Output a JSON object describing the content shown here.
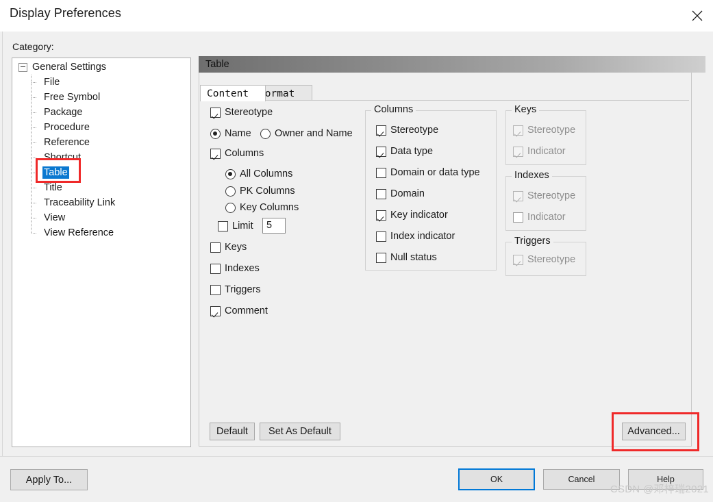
{
  "window": {
    "title": "Display Preferences",
    "close_icon": "close-icon"
  },
  "category": {
    "label": "Category:",
    "tree": [
      {
        "label": "General Settings",
        "level": 0,
        "expander": "minus",
        "selected": false
      },
      {
        "label": "File",
        "level": 1,
        "selected": false
      },
      {
        "label": "Free Symbol",
        "level": 1,
        "selected": false
      },
      {
        "label": "Package",
        "level": 1,
        "selected": false
      },
      {
        "label": "Procedure",
        "level": 1,
        "selected": false
      },
      {
        "label": "Reference",
        "level": 1,
        "selected": false
      },
      {
        "label": "Shortcut",
        "level": 1,
        "selected": false
      },
      {
        "label": "Table",
        "level": 1,
        "selected": true
      },
      {
        "label": "Title",
        "level": 1,
        "selected": false
      },
      {
        "label": "Traceability Link",
        "level": 1,
        "selected": false
      },
      {
        "label": "View",
        "level": 1,
        "selected": false
      },
      {
        "label": "View Reference",
        "level": 1,
        "selected": false
      }
    ]
  },
  "panel": {
    "header_title": "Table",
    "tabs": [
      {
        "label": "Content",
        "active": true
      },
      {
        "label": "Format",
        "active": false
      }
    ]
  },
  "content": {
    "stereotype": {
      "label": "Stereotype",
      "checked": true
    },
    "name_mode": {
      "name": {
        "label": "Name",
        "selected": true
      },
      "owner_and_name": {
        "label": "Owner and Name",
        "selected": false
      }
    },
    "columns": {
      "label": "Columns",
      "checked": true
    },
    "column_scope": {
      "all": {
        "label": "All Columns",
        "selected": true
      },
      "pk": {
        "label": "PK Columns",
        "selected": false
      },
      "key": {
        "label": "Key Columns",
        "selected": false
      }
    },
    "limit": {
      "label": "Limit",
      "checked": false,
      "value": "5"
    },
    "keys": {
      "label": "Keys",
      "checked": false
    },
    "indexes": {
      "label": "Indexes",
      "checked": false
    },
    "triggers": {
      "label": "Triggers",
      "checked": false
    },
    "comment": {
      "label": "Comment",
      "checked": true
    }
  },
  "columns_group": {
    "title": "Columns",
    "items": [
      {
        "label": "Stereotype",
        "checked": true,
        "disabled": false
      },
      {
        "label": "Data type",
        "checked": true,
        "disabled": false
      },
      {
        "label": "Domain or data type",
        "checked": false,
        "disabled": false
      },
      {
        "label": "Domain",
        "checked": false,
        "disabled": false
      },
      {
        "label": "Key indicator",
        "checked": true,
        "disabled": false
      },
      {
        "label": "Index indicator",
        "checked": false,
        "disabled": false
      },
      {
        "label": "Null status",
        "checked": false,
        "disabled": false
      }
    ]
  },
  "keys_group": {
    "title": "Keys",
    "items": [
      {
        "label": "Stereotype",
        "checked": true,
        "disabled": true
      },
      {
        "label": "Indicator",
        "checked": true,
        "disabled": true
      }
    ]
  },
  "indexes_group": {
    "title": "Indexes",
    "items": [
      {
        "label": "Stereotype",
        "checked": true,
        "disabled": true
      },
      {
        "label": "Indicator",
        "checked": false,
        "disabled": true
      }
    ]
  },
  "triggers_group": {
    "title": "Triggers",
    "items": [
      {
        "label": "Stereotype",
        "checked": true,
        "disabled": true
      }
    ]
  },
  "panel_buttons": {
    "default": "Default",
    "set_as_default": "Set As Default",
    "advanced": "Advanced..."
  },
  "footer": {
    "apply_to": "Apply To...",
    "ok": "OK",
    "cancel": "Cancel",
    "help": "Help"
  },
  "watermark": "CSDN @邓梓瑞2021",
  "colors": {
    "selection_blue": "#0b78d0",
    "annotation_red": "#ef2929",
    "focus_blue": "#0078d7"
  }
}
